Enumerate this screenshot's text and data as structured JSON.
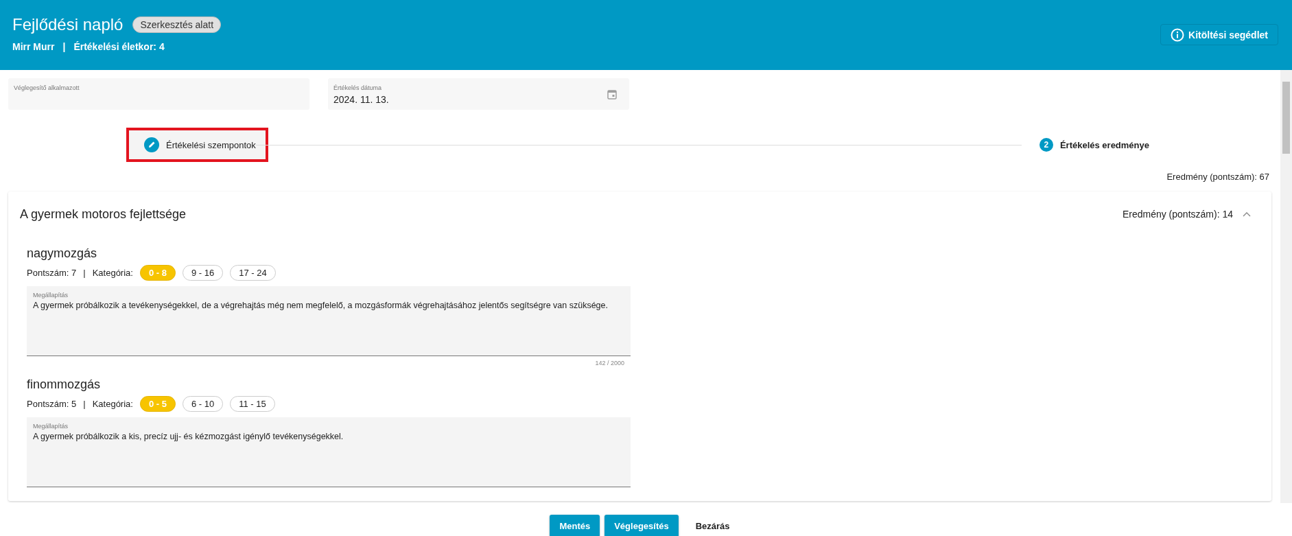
{
  "header": {
    "title": "Fejlődési napló",
    "status_badge": "Szerkesztés alatt",
    "child_name": "Mirr Murr",
    "separator": "|",
    "age_label": "Értékelési életkor: 4",
    "help_button": "Kitöltési segédlet"
  },
  "fields": [
    {
      "kind": "text",
      "label": "Véglegesítő alkalmazott"
    },
    {
      "kind": "date",
      "label": "Értékelés dátuma",
      "value": "2024. 11. 13."
    }
  ],
  "stepper": [
    {
      "label": "Értékelési szempontok",
      "selected": true,
      "highlighted": true,
      "kind": "icon"
    },
    {
      "label": "Értékelés eredménye",
      "selected": false,
      "highlighted": false,
      "kind": "number",
      "number": "2"
    }
  ],
  "total_score": "Eredmény (pontszám): 67",
  "section": {
    "title": "A gyermek motoros fejlettsége",
    "score": "Eredmény (pontszám): 14",
    "expanded": true,
    "items": [
      {
        "title": "nagymozgás",
        "points": "Pontszám: 7",
        "separator": "|",
        "category_label": "Kategória:",
        "categories": [
          {
            "label": "0 - 8",
            "selected": true
          },
          {
            "label": "9 - 16",
            "selected": false
          },
          {
            "label": "17 - 24",
            "selected": false
          }
        ],
        "field_label": "Megállapítás",
        "text": "A gyermek próbálkozik a tevékenységekkel, de a végrehajtás még nem megfelelő, a mozgásformák végrehajtásához jelentős segítségre van szüksége.",
        "counter": "142 / 2000"
      },
      {
        "title": "finommozgás",
        "points": "Pontszám: 5",
        "separator": "|",
        "category_label": "Kategória:",
        "categories": [
          {
            "label": "0 - 5",
            "selected": true
          },
          {
            "label": "6 - 10",
            "selected": false
          },
          {
            "label": "11 - 15",
            "selected": false
          }
        ],
        "field_label": "Megállapítás",
        "text": "A gyermek próbálkozik a kis, precíz ujj- és kézmozgást igénylő tevékenységekkel."
      }
    ]
  },
  "buttons": [
    {
      "kind": "primary",
      "label": "Mentés"
    },
    {
      "kind": "primary",
      "label": "Véglegesítés"
    },
    {
      "kind": "text",
      "label": "Bezárás"
    }
  ]
}
